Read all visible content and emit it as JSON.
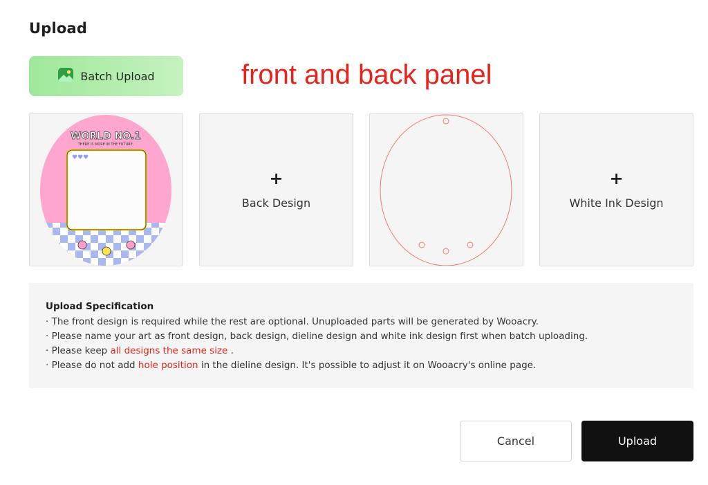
{
  "dialog": {
    "title": "Upload"
  },
  "batch_upload": {
    "label": "Batch Upload",
    "icon": "image-icon",
    "color": "#2f9e44"
  },
  "annotation": {
    "text": "front and back panel",
    "color": "#e8231c"
  },
  "panels": [
    {
      "name": "front",
      "artwork": {
        "heading": "WORLD NO.1",
        "tagline": "THERE IS MORE IN THE FUTURE."
      }
    },
    {
      "name": "back",
      "plus": "+",
      "label": "Back Design"
    },
    {
      "name": "dieline"
    },
    {
      "name": "white-ink",
      "plus": "+",
      "label": "White Ink Design"
    }
  ],
  "spec": {
    "title": "Upload Specification",
    "line1": "· The front design is required while the rest are optional. Unuploaded parts will be generated by Wooacry.",
    "line2": "· Please name your art as front design, back design, dieline design and white ink design first when batch uploading.",
    "line3": {
      "pre": "· Please keep ",
      "highlight": "all designs the same size",
      "post": " ."
    },
    "line4": {
      "pre": "· Please do not add ",
      "highlight": "hole position",
      "post": " in the dieline design. It's possible to adjust it on Wooacry's online page."
    },
    "highlight_color": "#e8231c"
  },
  "buttons": {
    "cancel": "Cancel",
    "upload": "Upload"
  }
}
